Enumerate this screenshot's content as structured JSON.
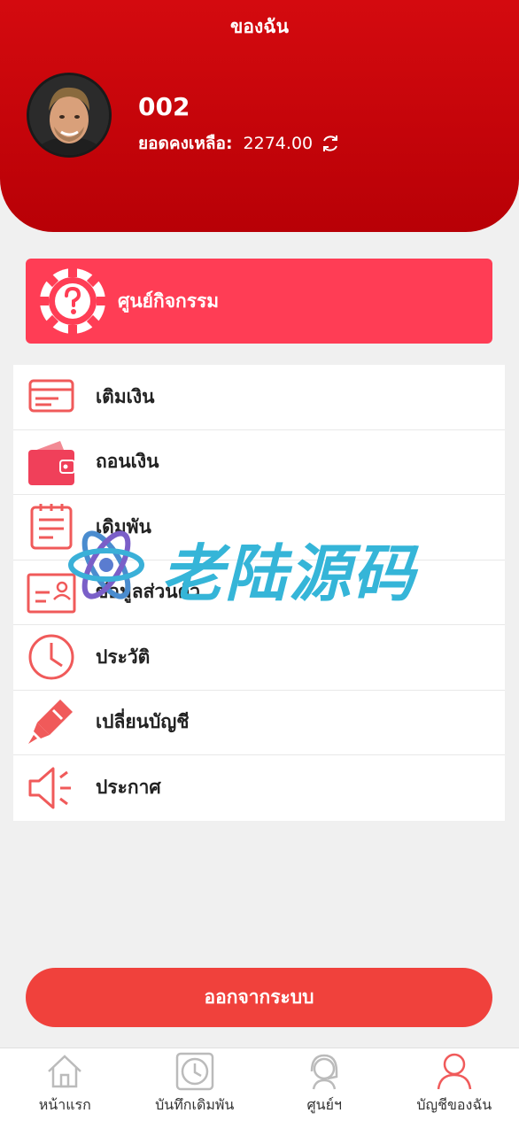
{
  "header": {
    "title": "ของฉัน",
    "username": "002",
    "balance_label": "ยอดคงเหลือ:",
    "balance_value": "2274.00"
  },
  "activity": {
    "label": "ศูนย์กิจกรรม"
  },
  "menu": {
    "items": [
      {
        "label": "เติมเงิน",
        "icon": "card-icon"
      },
      {
        "label": "ถอนเงิน",
        "icon": "wallet-icon"
      },
      {
        "label": "เดิมพัน",
        "icon": "notepad-icon"
      },
      {
        "label": "ข้อมูลส่วนตัว",
        "icon": "id-card-icon"
      },
      {
        "label": "ประวัติ",
        "icon": "clock-icon"
      },
      {
        "label": "เปลี่ยนบัญชี",
        "icon": "marker-icon"
      },
      {
        "label": "ประกาศ",
        "icon": "megaphone-icon"
      }
    ]
  },
  "watermark": {
    "text": "老陆源码"
  },
  "logout_label": "ออกจากระบบ",
  "nav": {
    "items": [
      {
        "label": "หน้าแรก",
        "icon": "home-icon"
      },
      {
        "label": "บันทึกเดิมพัน",
        "icon": "clock-icon"
      },
      {
        "label": "ศูนย์ฯ",
        "icon": "support-icon"
      },
      {
        "label": "บัญชีของฉัน",
        "icon": "user-icon"
      }
    ],
    "active": 3
  },
  "colors": {
    "header": "#c8060b",
    "accent": "#ff3d55",
    "icon": "#f05a5a",
    "logout": "#f0413c"
  }
}
